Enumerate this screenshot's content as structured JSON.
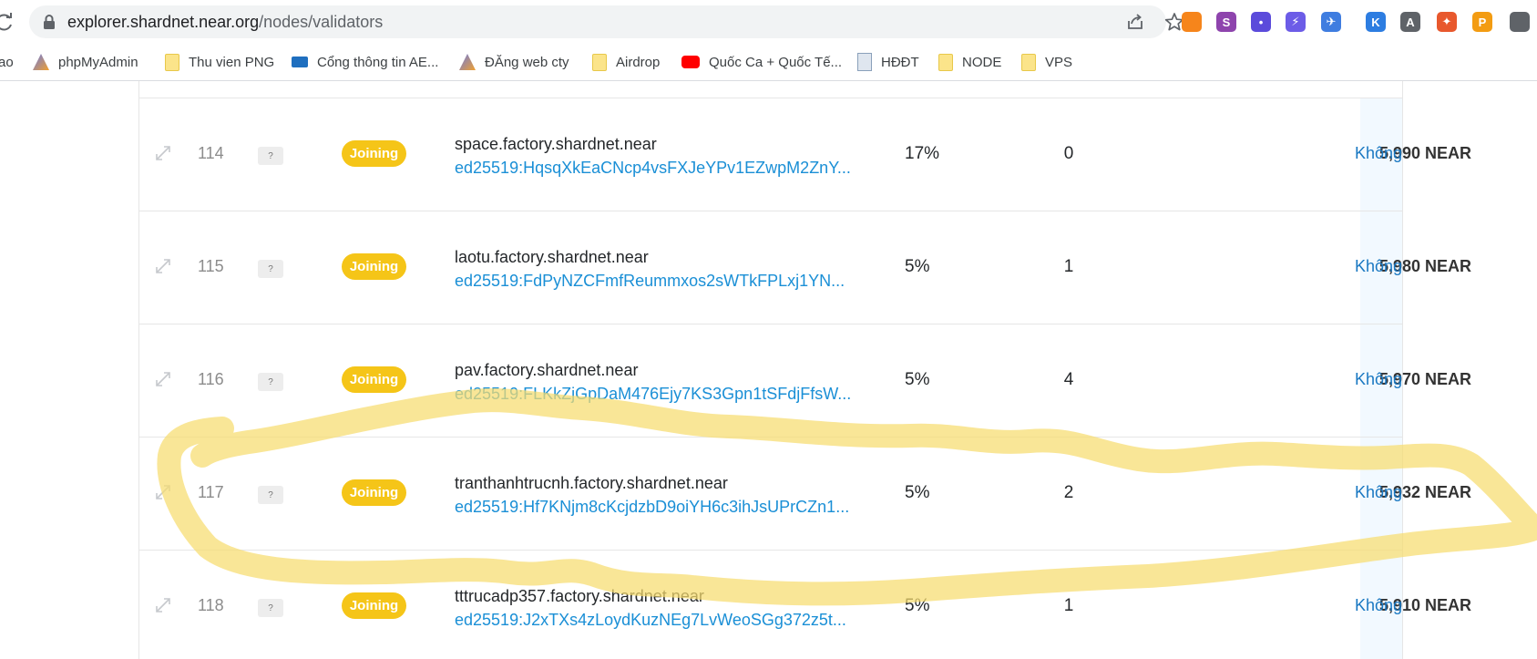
{
  "browser": {
    "url_host": "explorer.shardnet.near.org",
    "url_path": "/nodes/validators",
    "extensions": [
      {
        "name": "metamask-icon",
        "label": "",
        "color": "#f6851b"
      },
      {
        "name": "s-extension-icon",
        "label": "S",
        "color": "#8e44ad"
      },
      {
        "name": "keplr-face-icon",
        "label": "•",
        "color": "#5b4bdb"
      },
      {
        "name": "bolt-extension-icon",
        "label": "⚡",
        "color": "#6c5ce7"
      },
      {
        "name": "satellite-extension-icon",
        "label": "✈",
        "color": "#3f7de0"
      },
      {
        "name": "k-extension-icon",
        "label": "K",
        "color": "#2d7de1"
      },
      {
        "name": "a-extension-icon",
        "label": "A",
        "color": "#5f6368"
      },
      {
        "name": "gateio-extension-icon",
        "label": "✦",
        "color": "#e8582d"
      },
      {
        "name": "p-extension-icon",
        "label": "P",
        "color": "#f39c12"
      },
      {
        "name": "puzzle-extensions-icon",
        "label": "",
        "color": "#5f6368"
      }
    ]
  },
  "bookmarks": [
    {
      "label": "ao",
      "icon": "none"
    },
    {
      "label": "phpMyAdmin",
      "icon": "pma-icon"
    },
    {
      "label": "Thu vien PNG",
      "icon": "folder-icon"
    },
    {
      "label": "Cổng thông tin AE...",
      "icon": "aed-icon"
    },
    {
      "label": "ĐĂng web cty",
      "icon": "pma-icon"
    },
    {
      "label": "Airdrop",
      "icon": "folder-icon"
    },
    {
      "label": "Quốc Ca + Quốc Tế...",
      "icon": "youtube-icon"
    },
    {
      "label": "HĐĐT",
      "icon": "document-icon"
    },
    {
      "label": "NODE",
      "icon": "folder-icon"
    },
    {
      "label": "VPS",
      "icon": "folder-icon"
    }
  ],
  "validators": [
    {
      "index": "114",
      "badge": "?",
      "status": "Joining",
      "account": "space.factory.shardnet.near",
      "pubkey": "ed25519:HqsqXkEaCNcp4vsFXJeYPv1EZwpM2ZnY...",
      "fee": "17%",
      "delegators": "0",
      "stake": "5,990 NEAR",
      "extra": "Không"
    },
    {
      "index": "115",
      "badge": "?",
      "status": "Joining",
      "account": "laotu.factory.shardnet.near",
      "pubkey": "ed25519:FdPyNZCFmfReummxos2sWTkFPLxj1YN...",
      "fee": "5%",
      "delegators": "1",
      "stake": "5,980 NEAR",
      "extra": "Không"
    },
    {
      "index": "116",
      "badge": "?",
      "status": "Joining",
      "account": "pav.factory.shardnet.near",
      "pubkey": "ed25519:FLKkZjGpDaM476Ejy7KS3Gpn1tSFdjFfsW...",
      "fee": "5%",
      "delegators": "4",
      "stake": "5,970 NEAR",
      "extra": "Không"
    },
    {
      "index": "117",
      "badge": "?",
      "status": "Joining",
      "account": "tranthanhtrucnh.factory.shardnet.near",
      "pubkey": "ed25519:Hf7KNjm8cKcjdzbD9oiYH6c3ihJsUPrCZn1...",
      "fee": "5%",
      "delegators": "2",
      "stake": "5,932 NEAR",
      "extra": "Không"
    },
    {
      "index": "118",
      "badge": "?",
      "status": "Joining",
      "account": "tttrucadp357.factory.shardnet.near",
      "pubkey": "ed25519:J2xTXs4zLoydKuzNEg7LvWeoSGg372z5t...",
      "fee": "5%",
      "delegators": "1",
      "stake": "5,910 NEAR",
      "extra": "Không"
    }
  ],
  "colors": {
    "joining_badge": "#f5c518",
    "pubkey_link": "#1a8fd6",
    "highlight_scribble": "#f7dc6f"
  }
}
